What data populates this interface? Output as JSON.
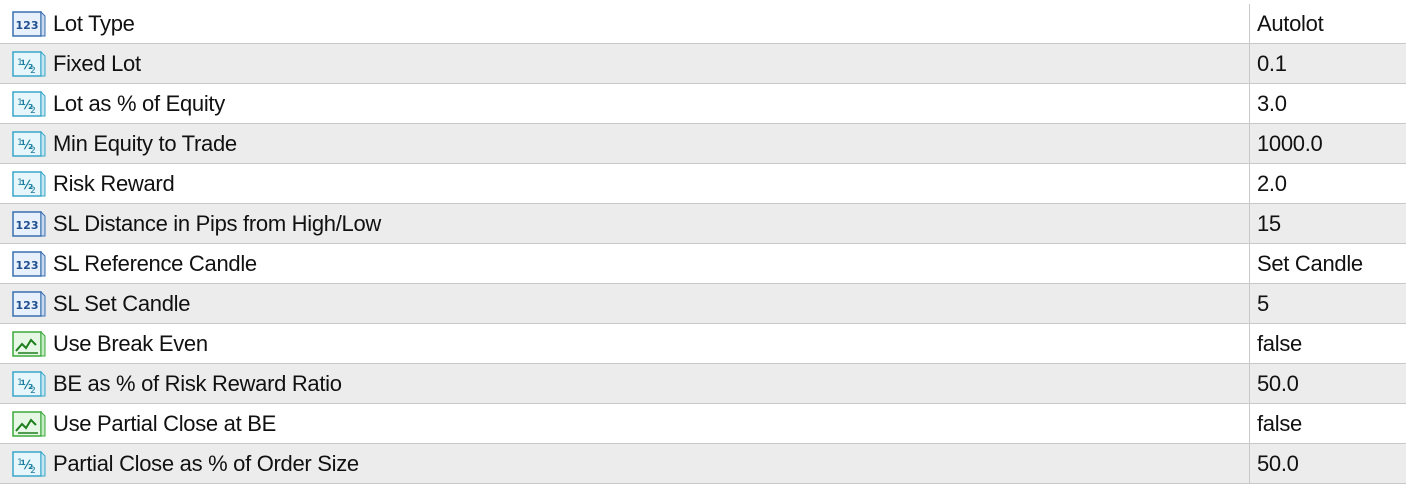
{
  "params": [
    {
      "icon": "integer-icon",
      "name": "Lot Type",
      "value": "Autolot"
    },
    {
      "icon": "double-icon",
      "name": "Fixed Lot",
      "value": "0.1"
    },
    {
      "icon": "double-icon",
      "name": "Lot as % of Equity",
      "value": "3.0"
    },
    {
      "icon": "double-icon",
      "name": "Min Equity to Trade",
      "value": "1000.0"
    },
    {
      "icon": "double-icon",
      "name": "Risk Reward",
      "value": "2.0"
    },
    {
      "icon": "integer-icon",
      "name": "SL Distance in Pips from High/Low",
      "value": "15"
    },
    {
      "icon": "integer-icon",
      "name": "SL Reference Candle",
      "value": "Set Candle"
    },
    {
      "icon": "integer-icon",
      "name": "SL Set Candle",
      "value": "5"
    },
    {
      "icon": "boolean-icon",
      "name": "Use Break Even",
      "value": "false"
    },
    {
      "icon": "double-icon",
      "name": "BE as % of Risk Reward Ratio",
      "value": "50.0"
    },
    {
      "icon": "boolean-icon",
      "name": "Use Partial Close at BE",
      "value": "false"
    },
    {
      "icon": "double-icon",
      "name": "Partial Close as % of Order Size",
      "value": "50.0"
    }
  ],
  "colors": {
    "row_alt": "#ececec",
    "row_plain": "#ffffff",
    "grid_line": "#c8c8c8",
    "integer_icon": "#3a6fb0",
    "double_icon": "#3aa7c9",
    "boolean_icon": "#3aa83a"
  }
}
